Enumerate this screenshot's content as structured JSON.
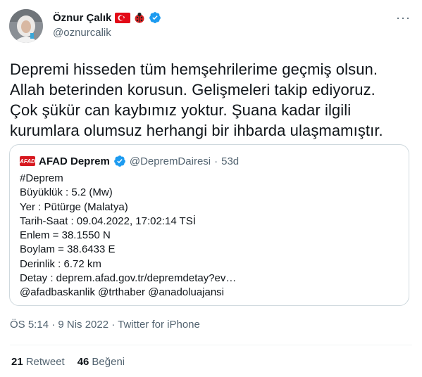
{
  "author": {
    "name": "Öznur Çalık",
    "handle": "@oznurcalik",
    "icons": [
      "turkey-flag-icon",
      "ladybug-icon",
      "verified-badge-icon"
    ],
    "verified_color": "#1d9bf0"
  },
  "more_label": "···",
  "tweet": {
    "lines": [
      "Depremi hisseden tüm hemşehrilerime geçmiş olsun.",
      "Allah beterinden korusun. Gelişmeleri takip ediyoruz.",
      "Çok şükür can kaybımız yoktur. Şuana kadar ilgili",
      "kurumlara olumsuz herhangi bir ihbarda ulaşmamıştır."
    ]
  },
  "quote": {
    "logo_text": "AFAD",
    "name": "AFAD Deprem",
    "handle": "@DepremDairesi",
    "separator": "·",
    "time": "53d",
    "lines": [
      "#Deprem",
      "Büyüklük : 5.2 (Mw)",
      "Yer : Pütürge (Malatya)",
      "Tarih-Saat : 09.04.2022, 17:02:14 TSİ",
      "Enlem = 38.1550 N",
      "Boylam = 38.6433 E",
      "Derinlik : 6.72 km",
      "Detay : deprem.afad.gov.tr/depremdetay?ev…",
      "@afadbaskanlik @trthaber @anadoluajansi"
    ]
  },
  "meta": "ÖS 5:14 · 9 Nis 2022 · Twitter for iPhone",
  "stats": {
    "retweets_count": "21",
    "retweets_label": "Retweet",
    "likes_count": "46",
    "likes_label": "Beğeni"
  }
}
